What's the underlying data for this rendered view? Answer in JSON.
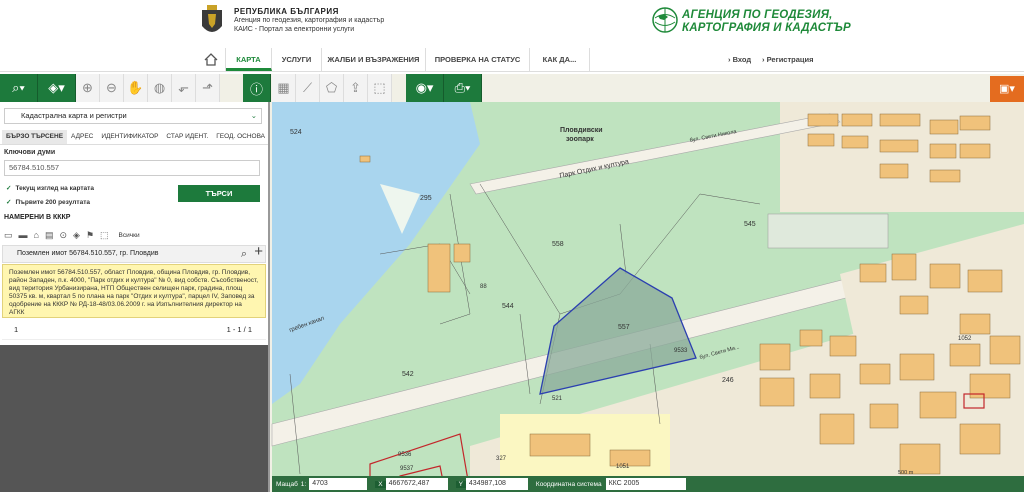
{
  "header": {
    "gov_title": "РЕПУБЛИКА БЪЛГАРИЯ",
    "gov_line2": "Агенция по геодезия, картография и кадастър",
    "gov_line3": "КАИС - Портал за електронни услуги",
    "agency_line1": "АГЕНЦИЯ ПО ГЕОДЕЗИЯ,",
    "agency_line2": "КАРТОГРАФИЯ И КАДАСТЪР"
  },
  "nav": {
    "items": [
      {
        "label": "КАРТА"
      },
      {
        "label": "УСЛУГИ"
      },
      {
        "label": "ЖАЛБИ И ВЪЗРАЖЕНИЯ"
      },
      {
        "label": "ПРОВЕРКА НА СТАТУС"
      },
      {
        "label": "КАК ДА..."
      }
    ],
    "login": "› Вход",
    "register": "› Регистрация"
  },
  "panel": {
    "layer_select": "Кадастрална карта и регистри",
    "tabs": [
      {
        "label": "БЪРЗО ТЪРСЕНЕ"
      },
      {
        "label": "АДРЕС"
      },
      {
        "label": "ИДЕНТИФИКАТОР"
      },
      {
        "label": "СТАР ИДЕНТ."
      },
      {
        "label": "ГЕОД. ОСНОВА"
      }
    ],
    "keywords_label": "Ключови думи",
    "keywords_value": "56784.510.557",
    "check_current_view": "Текущ изглед на картата",
    "check_first_200": "Първите 200 резултата",
    "search_button": "ТЪРСИ",
    "found_title": "НАМЕРЕНИ В КККР",
    "all_label": "Всички",
    "result_title": "Поземлен имот 56784.510.557, гр. Пловдив",
    "result_description": "Поземлен имот 56784.510.557, област Пловдив, община Пловдив, гр. Пловдив, район Западен, п.к. 4000, \"Парк отдих и култура\" № 0, вид собств. Съсобственост, вид територия Урбанизирана, НТП Обществен селищен парк, градина, площ 50375 кв. м, квартал 5 по плана на парк \"Отдих и култура\", парцел IV, Заповед за одобрение на КККР № РД-18-48/03.06.2009 г. на Изпълнителния директор на АГКК",
    "page_number": "1",
    "page_range": "1 - 1 / 1"
  },
  "map": {
    "labels": {
      "zoo": "Пловдивски",
      "zoo2": "зоопарк",
      "street1": "бул. Свети Никола",
      "street2": "Парк Отдих и култура",
      "street3": "бул. Свети Ми...",
      "canal": "гребен канал",
      "parcel_524": "524",
      "parcel_295": "295",
      "parcel_558": "558",
      "parcel_545": "545",
      "parcel_544": "544",
      "parcel_557": "557",
      "parcel_542": "542",
      "parcel_246": "246",
      "parcel_9533": "9533",
      "parcel_9536": "9536",
      "parcel_9537": "9537",
      "parcel_327": "327",
      "parcel_1052": "1052",
      "parcel_1051": "1051",
      "parcel_88": "88",
      "parcel_521": "521",
      "scale": "500 m"
    }
  },
  "bottombar": {
    "scale_label": "Мащаб",
    "scale_prefix": "1:",
    "scale_value": "4703",
    "x_label": "X",
    "x_value": "4667672,487",
    "y_label": "Y",
    "y_value": "434987,108",
    "crs_label": "Координатна система",
    "crs_value": "ККС 2005"
  },
  "colors": {
    "accent_green": "#1d7a3c",
    "selected_parcel": "#2b3fb0",
    "highlight_card": "#fff6b0",
    "orange": "#e46c1f"
  }
}
